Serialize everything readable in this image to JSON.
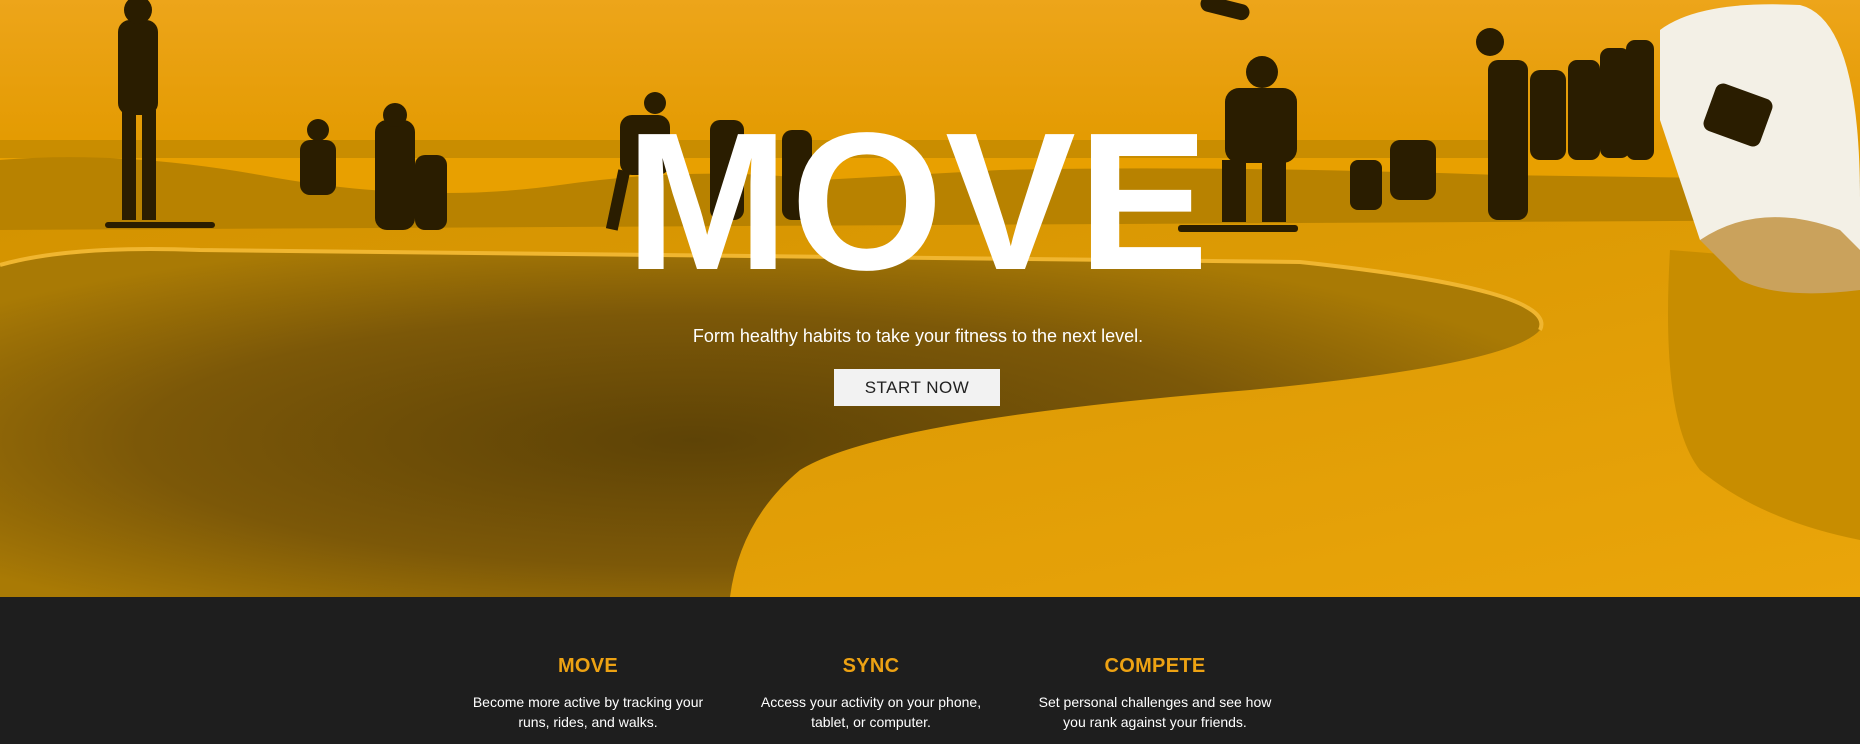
{
  "colors": {
    "hero_tint": "#e8a000",
    "accent": "#eda213",
    "footer_bg": "#1e1e1e",
    "button_bg": "#f2f2f2"
  },
  "hero": {
    "title": "MOVE",
    "subtitle": "Form healthy habits to take your fitness to the next level.",
    "cta_label": "START NOW",
    "background_image": "skatepark-photo"
  },
  "features": [
    {
      "title": "MOVE",
      "line1": "Become more active by tracking your",
      "line2": "runs, rides, and walks."
    },
    {
      "title": "SYNC",
      "line1": "Access your activity on your phone,",
      "line2": "tablet, or computer."
    },
    {
      "title": "COMPETE",
      "line1": "Set personal challenges and see how",
      "line2": "you rank against your friends."
    }
  ]
}
